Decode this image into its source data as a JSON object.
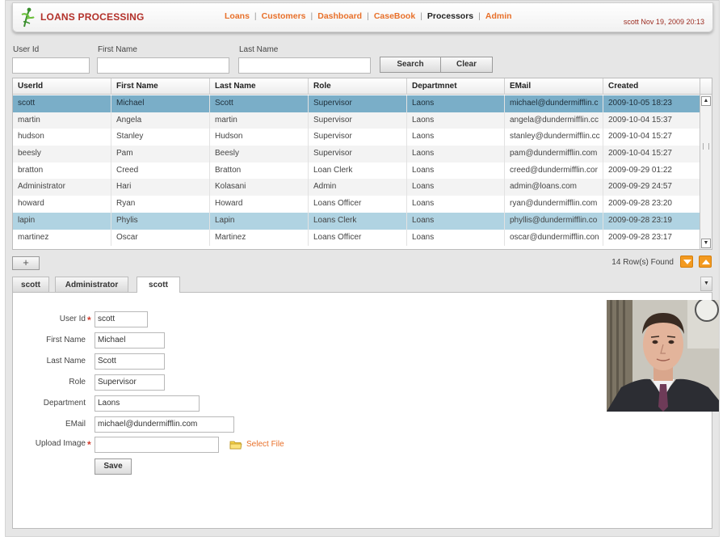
{
  "header": {
    "title": "LOANS PROCESSING",
    "nav": [
      {
        "label": "Loans",
        "active": false
      },
      {
        "label": "Customers",
        "active": false
      },
      {
        "label": "Dashboard",
        "active": false
      },
      {
        "label": "CaseBook",
        "active": false
      },
      {
        "label": "Processors",
        "active": true
      },
      {
        "label": "Admin",
        "active": false
      }
    ],
    "user_stamp": "scott Nov 19, 2009 20:13"
  },
  "search": {
    "userid_label": "User Id",
    "firstname_label": "First Name",
    "lastname_label": "Last Name",
    "userid_value": "",
    "firstname_value": "",
    "lastname_value": "",
    "search_button": "Search",
    "clear_button": "Clear"
  },
  "grid": {
    "columns": [
      "UserId",
      "First Name",
      "Last Name",
      "Role",
      "Departmnet",
      "EMail",
      "Created"
    ],
    "rows": [
      [
        "scott",
        "Michael",
        "Scott",
        "Supervisor",
        "Laons",
        "michael@dundermifflin.c",
        "2009-10-05 18:23"
      ],
      [
        "martin",
        "Angela",
        "martin",
        "Supervisor",
        "Laons",
        "angela@dundermifflin.cc",
        "2009-10-04 15:37"
      ],
      [
        "hudson",
        "Stanley",
        "Hudson",
        "Supervisor",
        "Laons",
        "stanley@dundermifflin.cc",
        "2009-10-04 15:27"
      ],
      [
        "beesly",
        "Pam",
        "Beesly",
        "Supervisor",
        "Laons",
        "pam@dundermifflin.com",
        "2009-10-04 15:27"
      ],
      [
        "bratton",
        "Creed",
        "Bratton",
        "Loan Clerk",
        "Loans",
        "creed@dundermifflin.cor",
        "2009-09-29 01:22"
      ],
      [
        "Administrator",
        "Hari",
        "Kolasani",
        "Admin",
        "Loans",
        "admin@loans.com",
        "2009-09-29 24:57"
      ],
      [
        "howard",
        "Ryan",
        "Howard",
        "Loans Officer",
        "Loans",
        "ryan@dundermifflin.com",
        "2009-09-28 23:20"
      ],
      [
        "lapin",
        "Phylis",
        "Lapin",
        "Loans Clerk",
        "Loans",
        "phyllis@dundermifflin.co",
        "2009-09-28 23:19"
      ],
      [
        "martinez",
        "Oscar",
        "Martinez",
        "Loans Officer",
        "Loans",
        "oscar@dundermifflin.con",
        "2009-09-28 23:17"
      ]
    ],
    "selected_row": 0,
    "highlighted_row": 7,
    "rows_found": "14 Row(s) Found",
    "add_button": "+"
  },
  "tabs": [
    {
      "label": "scott",
      "active": false
    },
    {
      "label": "Administrator",
      "active": false
    },
    {
      "label": "scott",
      "active": true
    }
  ],
  "form": {
    "userid_label": "User Id",
    "firstname_label": "First Name",
    "lastname_label": "Last Name",
    "role_label": "Role",
    "department_label": "Department",
    "email_label": "EMail",
    "upload_label": "Upload Image",
    "userid_value": "scott",
    "firstname_value": "Michael",
    "lastname_value": "Scott",
    "role_value": "Supervisor",
    "department_value": "Laons",
    "email_value": "michael@dundermifflin.com",
    "upload_value": "",
    "required_mark": "*",
    "select_file": "Select File",
    "save_button": "Save"
  },
  "icons": {
    "logo": "leaf-figure-logo",
    "scroll_up": "triangle-up-icon",
    "scroll_down": "triangle-down-icon",
    "page_prev": "chevron-down-icon",
    "page_next": "chevron-up-icon",
    "tab_menu": "triangle-down-icon",
    "folder": "folder-icon"
  },
  "colors": {
    "title": "#b3312a",
    "nav_link": "#e8702a",
    "selected_row": "#7aaec8",
    "highlight_row": "#b0d3e2",
    "required": "#d23b2c",
    "pager": "#f39a20"
  }
}
